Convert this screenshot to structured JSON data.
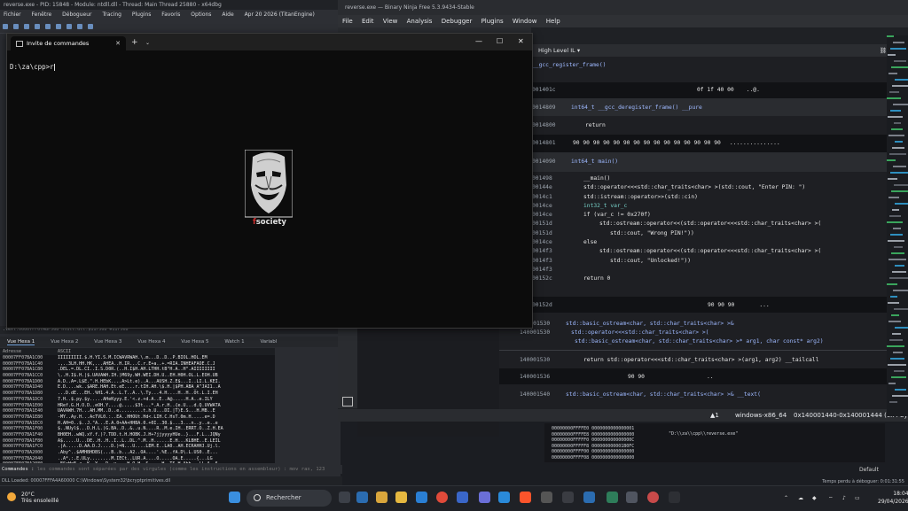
{
  "x64dbg": {
    "title": "reverse.exe - PID: 15848 - Module: ntdll.dll - Thread: Main Thread 25880 - x64dbg",
    "menu": [
      "Fichier",
      "Fenêtre",
      "Débogueur",
      "Tracing",
      "Plugins",
      "Favoris",
      "Options",
      "Aide",
      "Apr 20 2026 (TitanEngine)"
    ],
    "addr_line": ".text:00007FF07ABF568 ntdll.dll:$11F568 #11F568",
    "dump_tabs": [
      "Vue Hexa 1",
      "Vue Hexa 2",
      "Vue Hexa 3",
      "Vue Hexa 4",
      "Vue Hexa 5",
      "Watch 1",
      "Variabl"
    ],
    "dump_header": {
      "address": "Adresse",
      "ascii": "ASCII"
    },
    "dump_rows": [
      {
        "addr": "00007FF07BA1C00",
        "hex": "IIIIIIIII.$.H.YI.S.M.ICWAVRWAH.\\.m...D..D..P.BIOL.HOL.EM"
      },
      {
        "addr": "00007FF07BA1C40",
        "hex": ".,..3LH.HH.HK,...AHEA..H.IR...C.r.E+a..+.=RIA.INHEAFAOE.C.J"
      },
      {
        "addr": "00007FF07BA1C80",
        "hex": ".DEL.=.DL.CI..I.S.D0R.(..H.I$H.AH.LTHH.tB\"H.A..H\".AIIIIIIII"
      },
      {
        "addr": "00007FF07BA1CC0",
        "hex": "\\..H.I$.H.|$.UAVAWH.IH.)M69y.WH.WEI.DH.U..EH.H0H.OL.L.EOH.UB"
      },
      {
        "addr": "00007FF07BA1D00",
        "hex": "A.D..A=.L$E.\".H.HEbK....A>Lt.e)..A...AUSH.Z.E$...I..LI.L.KEI."
      },
      {
        "addr": "00007FF07BA1D40",
        "hex": "E.D....wk..$ARE.HAH.Et.eE....r.tIH.AH.\\$.H.|$PH.ABA_A^JAI1..A"
      },
      {
        "addr": "00007FF07BA1D80",
        "hex": "...D.dE...EH..%H1.4.A..L.T..A..\\.Ty...4.H....H..H..Ot.L.I.EH"
      },
      {
        "addr": "00007FF07BA1DC0",
        "hex": "7.H..$.py.$y.....AHeKyyy.E.'<.z.+d.A..E..A@.....H.A..e.ILY"
      },
      {
        "addr": "00007FF07BA1E00",
        "hex": "HRef.G.H.O.D..eOH.Y....@.....$3t...*.A.r.H..{e.U...d.Q.UVWATA"
      },
      {
        "addr": "00007FF07BA1E40",
        "hex": "UAVAWH.7H...AH.MM..D..e.........t.h.U...DI.|T)E.S...H.MB..E"
      },
      {
        "addr": "00007FF07BA1E80",
        "hex": "-MY..Ay.H...AcTVL0.:..EA..HHOUt.Hd<.LIH.C.HsT.0m.H.....e=.D"
      },
      {
        "addr": "00007FF07BA1EC0",
        "hex": "H.AH=0..$..J.\"A...E.A.0+AA+HHBA.0.+0I..30.$...3...n..y..e..e"
      },
      {
        "addr": "00007FF07BA1F00",
        "hex": "$..NUyl$...D.H.L.)G.BA..D..&..u.N....R..M.e.IH..ERRT.O..Z.H.EA"
      },
      {
        "addr": "00007FF07BA1F40",
        "hex": "BH0EH..wWQ.xY.f.)?.TDD.t.H.HOBK.J.H+?jjyyyyHUe..}...F.L..JQNy"
      },
      {
        "addr": "00007FF07BA1F80",
        "hex": "A$.....U...DE..H..H..I..L..DL.^.M..H......E.H...KLBHE..E.LEIL"
      },
      {
        "addr": "00007FF07BA1FC0",
        "hex": ".|A.....D.AA.D.J....D.)=N...U....LEM.E..LA0..AH.ECRAHHJ.Uj.l."
      },
      {
        "addr": "00007FF07BA2000",
        "hex": ".Aby^..$AMHBHDBS(...B..b...A2..OA....'.%E..fA.D\\.L.US0..E..."
      },
      {
        "addr": "00007FF07BA2040",
        "hex": "..A*.:.E.ULy........M.IECt..LUR.A....O.....OA.E.....{...LG"
      },
      {
        "addr": "00007FF07BA2080",
        "hex": ".ESoHeE.<..K..Y...D..y.,..H.O.H..S.....H..TS.H.Abb...LL.A..6.."
      },
      {
        "addr": "00007FF07BA20C0",
        "hex": "fCG.\\.)4j..HNL.$HI.<..\\.H..H.A.fA.u.fA.uGA..Qt.T.fA.u..H.S.."
      },
      {
        "addr": "00007FF07BA2100",
        "hex": "M...E...,.H.A.Ac.....H.I..A.M..O..A.NAA.A.LHA..EAGHANT..LAA.."
      }
    ],
    "command_label": "Commandes :",
    "command_hint": "les commandes sont séparées par des virgules (comme les instructions en assembleur) : mov rax, 123",
    "status_dll": "DLL Loaded: 00007FFFA4A60000 C:\\Windows\\System32\\bcryptprimitives.dll",
    "status_right": "Temps perdu à déboguer: 0:01:31:55",
    "default_label": "Default"
  },
  "cmd": {
    "tab_title": "Invite de commandes",
    "prompt": "D:\\za\\cpp>r",
    "logo_text_prefix": "f",
    "logo_text_rest": "society"
  },
  "binja": {
    "title": "reverse.exe — Binary Ninja Free 5.3.9434-Stable",
    "menu": [
      "File",
      "Edit",
      "View",
      "Analysis",
      "Debugger",
      "Plugins",
      "Window",
      "Help"
    ],
    "view_mode": "High Level IL",
    "lines": [
      {
        "addr": "",
        "text": "__gcc_register_frame()"
      },
      {
        "addr": "001401c",
        "text": "0f 1f 40 00",
        "ascii": "..@."
      },
      {
        "addr": "0014809",
        "text": "int64_t __gcc_deregister_frame() __pure"
      },
      {
        "addr": "0014800",
        "text": "return"
      },
      {
        "addr": "0014801",
        "text": "90 90 90 90 90 90 90 90 90 90 90 90 90 90 90",
        "ascii": "..............."
      },
      {
        "addr": "0014090",
        "text": "int64_t main()"
      }
    ],
    "main_body": [
      {
        "addr": "001498",
        "code": "__main()"
      },
      {
        "addr": "00144e",
        "code": "std::operator<<<std::char_traits<char> >(std::cout, \"Enter PIN: \")"
      },
      {
        "addr": "0014c1",
        "code": "std::istream::operator>>(std::cin)"
      },
      {
        "addr": "0014ce",
        "code": "int32_t var_c"
      },
      {
        "addr": "0014ce",
        "code": "if (var_c != 0x270f)"
      },
      {
        "addr": "00151d",
        "code": "std::ostream::operator<<(std::operator<<<std::char_traits<char> >("
      },
      {
        "addr": "00151d",
        "code": "std::cout, \"Wrong PIN!\"))"
      },
      {
        "addr": "0014ce",
        "code": "else"
      },
      {
        "addr": "0014f3",
        "code": "std::ostream::operator<<(std::operator<<<std::char_traits<char> >("
      },
      {
        "addr": "0014f3",
        "code": "std::cout, \"Unlocked!\"))"
      },
      {
        "addr": "0014f3",
        "code": ""
      },
      {
        "addr": "00152c",
        "code": "return 0"
      }
    ],
    "after": [
      {
        "addr": "00152d",
        "text": "90 90 90",
        "ascii": "..."
      },
      {
        "addr": "140001530",
        "text": "std::basic_ostream<char, std::char_traits<char> >&"
      },
      {
        "addr": "140001530",
        "text": "std::operator<<<std::char_traits<char> >("
      },
      {
        "addr": "",
        "text": "std::basic_ostream<char, std::char_traits<char> >* arg1, char const* arg2)"
      },
      {
        "addr": "140001530",
        "text": "return std::operator<<<std::char_traits<char> >(arg1, arg2) __tailcall"
      },
      {
        "addr": "140001536",
        "text": "90 90",
        "ascii": ".."
      },
      {
        "addr": "140001540",
        "text": "std::basic_ostream<char, std::char_traits<char> >& __text("
      }
    ],
    "status_warn": "1",
    "status_arch": "windows-x86_64",
    "status_range": "0x140001440-0x140001444 (0x4 bytes)"
  },
  "regs": {
    "lines": [
      "00000000FFFFE0  0000000000000001",
      "00000000FFFFE8  0000000000000000",
      "00000000FFFFF0  000000000000000C",
      "00000000FFFFF8  000000000001B0FC",
      "00000000FFFF00  0000000000000000",
      "00000000FFFF08  0000000000000000"
    ],
    "string": "\"D:\\\\za\\\\cpp\\\\reverse.exe\""
  },
  "taskbar": {
    "temp": "20°C",
    "weather": "Très ensoleillé",
    "search": "Rechercher",
    "time": "18:04",
    "date": "29/04/2026"
  }
}
